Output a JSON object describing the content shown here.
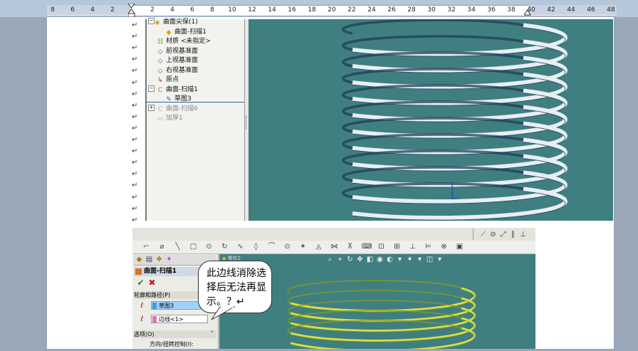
{
  "ruler": {
    "left_numbers": [
      "8",
      "6",
      "4",
      "2"
    ],
    "right_numbers": [
      "2",
      "4",
      "6",
      "8",
      "10",
      "12",
      "14",
      "16",
      "18",
      "20",
      "22",
      "24",
      "26",
      "28",
      "30",
      "32",
      "34",
      "36",
      "38",
      "40",
      "42",
      "44",
      "46",
      "48"
    ]
  },
  "paragraph_mark": "↵",
  "feature_tree": {
    "items": [
      {
        "label": "曲面尖保(1)",
        "icon": "part-icon"
      },
      {
        "label": "曲面-扫描1",
        "icon": "sweep-icon"
      },
      {
        "label": "材质 <未指定>",
        "icon": "material-icon"
      },
      {
        "label": "前视基准面",
        "icon": "plane-icon"
      },
      {
        "label": "上视基准面",
        "icon": "plane-icon"
      },
      {
        "label": "右视基准面",
        "icon": "plane-icon"
      },
      {
        "label": "原点",
        "icon": "origin-icon"
      },
      {
        "label": "曲面-扫描1",
        "icon": "surface-icon"
      },
      {
        "label": "草图3",
        "icon": "sketch-icon"
      },
      {
        "label": "曲面-扫描6",
        "icon": "surface-icon",
        "suppressed": true
      },
      {
        "label": "加厚1",
        "icon": "thicken-icon",
        "suppressed": true
      }
    ]
  },
  "property_manager": {
    "title": "曲面-扫描1",
    "section_profile": "轮廓和路径(P)",
    "profile_value": "草图3",
    "path_value": "边线<1>",
    "section_options": "选项(O)",
    "orientation_label": "方向/扭转控制(I):",
    "tree_tab_label": "零件2"
  },
  "callout": {
    "text": "此边线消除选择后无法再显示。？↵"
  },
  "colors": {
    "viewport": "#3f7f80",
    "ribbon": "#e8eef4",
    "ribbon_selected": "#d8e04a"
  }
}
